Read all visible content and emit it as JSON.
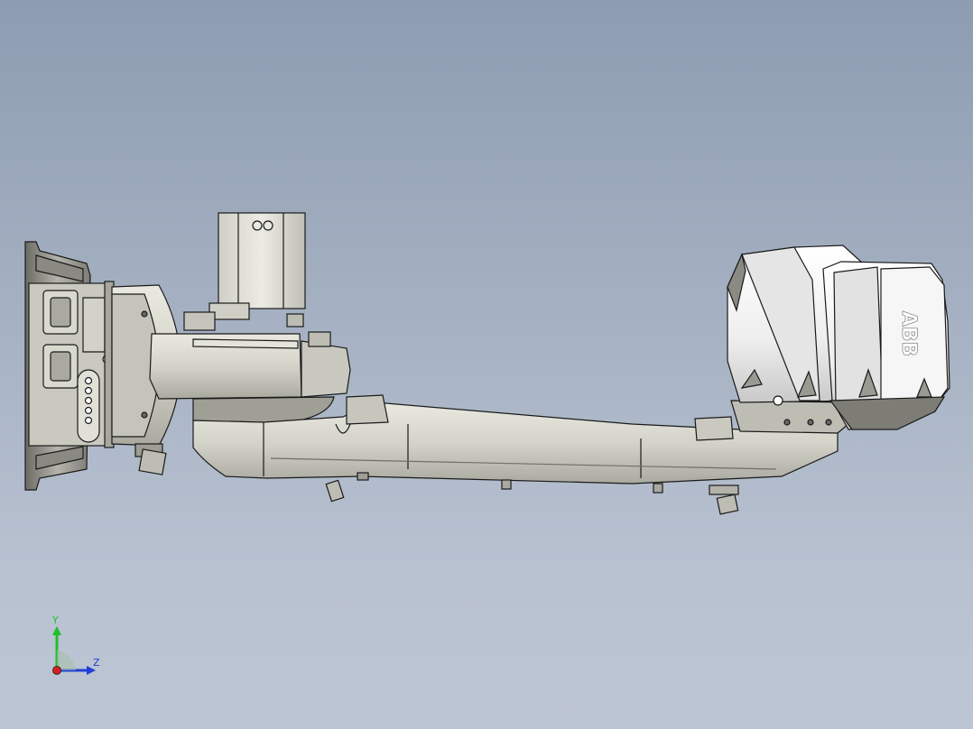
{
  "viewport": {
    "background_top": "#8d9cb1",
    "background_bottom": "#bcc5d3"
  },
  "model": {
    "name": "robot-arm-side-view",
    "logo_text": "ABB",
    "body_color": "#d8d8cf",
    "shadow_color": "#9a9a90",
    "cover_color": "#f2f2f2",
    "edge_color": "#1a1a1a"
  },
  "triad": {
    "y_label": "Y",
    "z_label": "Z",
    "y_color": "#1fbf2b",
    "z_color": "#1f3fd6",
    "x_color": "#d62020"
  }
}
